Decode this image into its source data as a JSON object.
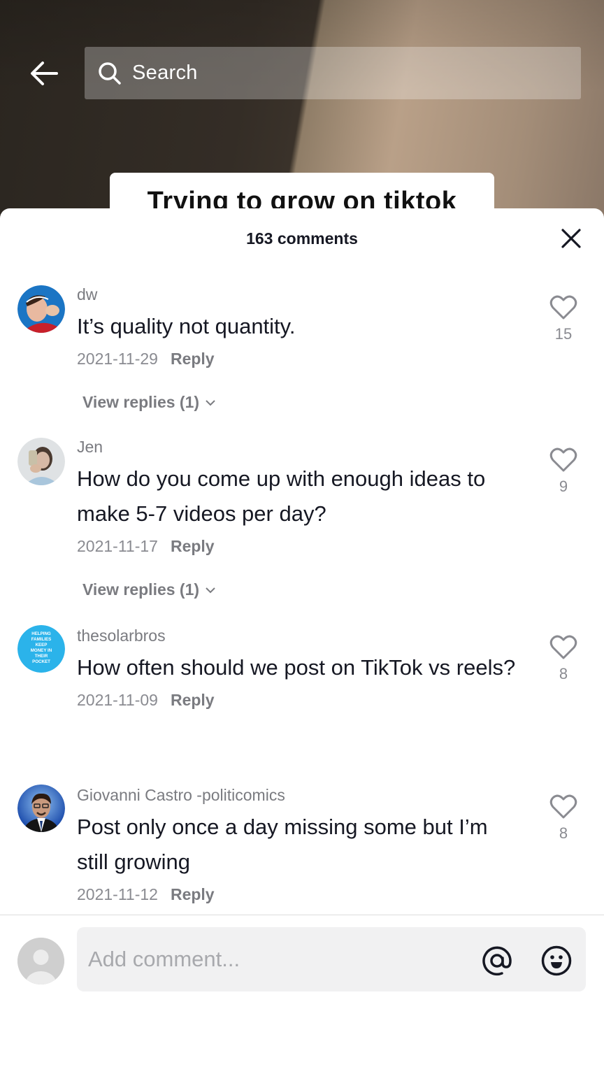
{
  "header": {
    "back_icon": "arrow-left-icon",
    "search_icon": "search-icon",
    "search_placeholder": "Search",
    "video_caption": "Trying to grow on tiktok"
  },
  "sheet": {
    "title": "163 comments",
    "close_icon": "close-icon"
  },
  "comments": [
    {
      "username": "dw",
      "text": "It’s quality not quantity.",
      "date": "2021-11-29",
      "reply_label": "Reply",
      "likes": "15",
      "view_replies": "View replies (1)"
    },
    {
      "username": "Jen",
      "text": "How do you come up with enough ideas to make 5-7 videos per day?",
      "date": "2021-11-17",
      "reply_label": "Reply",
      "likes": "9",
      "view_replies": "View replies (1)"
    },
    {
      "username": "thesolarbros",
      "text": "How often should we post on TikTok vs reels?",
      "date": "2021-11-09",
      "reply_label": "Reply",
      "likes": "8",
      "avatar_text": "HELPING FAMILIES KEEP MONEY IN THEIR POCKET"
    },
    {
      "username": "Giovanni Castro -politicomics",
      "text": "Post only once a day missing some but I’m still growing",
      "date": "2021-11-12",
      "reply_label": "Reply",
      "likes": "8"
    }
  ],
  "composer": {
    "placeholder": "Add comment...",
    "mention_icon": "at-sign-icon",
    "emoji_icon": "emoji-icon"
  },
  "colors": {
    "primary_text": "#161823",
    "secondary_text": "#8a8b91",
    "input_bg": "#f1f1f2",
    "divider": "#dcdcdc"
  }
}
